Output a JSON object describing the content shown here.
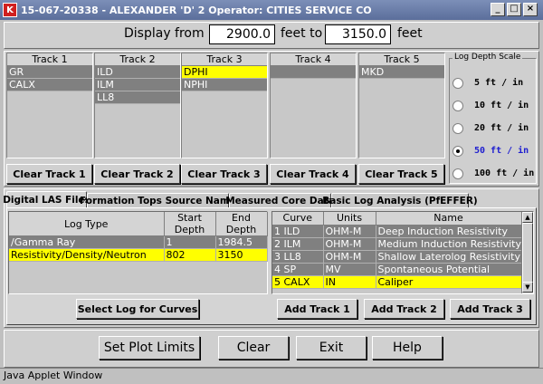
{
  "window": {
    "title": "15-067-20338 - ALEXANDER 'D' 2  Operator: CITIES SERVICE CO",
    "logo": "K",
    "min": "_",
    "max": "□",
    "close": "×"
  },
  "display": {
    "from_label": "Display from",
    "from_value": "2900.0",
    "to_label": "feet to",
    "to_value": "3150.0",
    "unit_label": "feet"
  },
  "tracks": [
    {
      "name": "Track 1",
      "items": [
        {
          "label": "GR",
          "highlight": false
        },
        {
          "label": "CALX",
          "highlight": false
        }
      ]
    },
    {
      "name": "Track 2",
      "items": [
        {
          "label": "ILD",
          "highlight": false
        },
        {
          "label": "ILM",
          "highlight": false
        },
        {
          "label": "LL8",
          "highlight": false
        }
      ]
    },
    {
      "name": "Track 3",
      "items": [
        {
          "label": "DPHI",
          "highlight": true
        },
        {
          "label": "NPHI",
          "highlight": false
        }
      ]
    },
    {
      "name": "Track 4",
      "items": [
        {
          "label": "",
          "highlight": false
        }
      ]
    },
    {
      "name": "Track 5",
      "items": [
        {
          "label": "MKD",
          "highlight": false
        }
      ]
    }
  ],
  "clear_buttons": [
    "Clear Track 1",
    "Clear Track 2",
    "Clear Track 3",
    "Clear Track 4",
    "Clear Track 5"
  ],
  "scale": {
    "title": "Log Depth Scale",
    "options": [
      "5 ft / in",
      "10 ft / in",
      "20 ft / in",
      "50 ft / in",
      "100 ft / in"
    ],
    "selected_index": 3
  },
  "tabs": [
    "Digital LAS Files",
    "Formation Tops Source Name",
    "Measured Core Data",
    "Basic Log Analysis (PfEFFER)"
  ],
  "active_tab": 0,
  "log_table": {
    "headers": [
      "Log Type",
      "Start Depth",
      "End Depth"
    ],
    "rows": [
      [
        "/Gamma Ray",
        "1",
        "1984.5"
      ],
      [
        "Resistivity/Density/Neutron",
        "802",
        "3150"
      ]
    ]
  },
  "select_button": "Select Log for Curves",
  "curve_table": {
    "headers": [
      "Curve",
      "Units",
      "Name"
    ],
    "rows": [
      [
        "1 ILD",
        "OHM-M",
        "Deep Induction Resistivity"
      ],
      [
        "2 ILM",
        "OHM-M",
        "Medium Induction Resistivity"
      ],
      [
        "3 LL8",
        "OHM-M",
        "Shallow Laterolog Resistivity"
      ],
      [
        "4 SP",
        "MV",
        "Spontaneous Potential"
      ],
      [
        "5 CALX",
        "IN",
        "Caliper"
      ]
    ],
    "selected_row": 4
  },
  "add_buttons": [
    "Add Track 1",
    "Add Track 2",
    "Add Track 3"
  ],
  "bottom_buttons": [
    "Set Plot Limits",
    "Clear",
    "Exit",
    "Help"
  ],
  "status": "Java Applet Window"
}
